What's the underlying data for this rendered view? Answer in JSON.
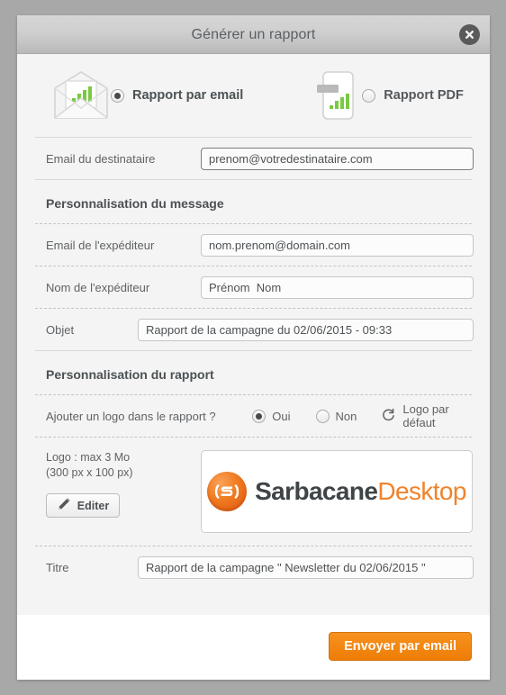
{
  "dialog": {
    "title": "Générer un rapport",
    "close_icon": "close-icon"
  },
  "report_type": {
    "options": [
      {
        "id": "email",
        "label": "Rapport par email",
        "selected": true,
        "icon": "envelope-chart-icon"
      },
      {
        "id": "pdf",
        "label": "Rapport PDF",
        "selected": false,
        "icon": "pdf-chart-icon"
      }
    ]
  },
  "recipient": {
    "label": "Email du destinataire",
    "value": "prenom@votredestinataire.com"
  },
  "message_section": {
    "heading": "Personnalisation du message",
    "fields": [
      {
        "id": "sender_email",
        "label": "Email de l'expéditeur",
        "value": "nom.prenom@domain.com"
      },
      {
        "id": "sender_name",
        "label": "Nom de l'expéditeur",
        "value": "Prénom  Nom"
      },
      {
        "id": "subject",
        "label": "Objet",
        "value": "Rapport de la campagne du 02/06/2015 - 09:33"
      }
    ]
  },
  "report_section": {
    "heading": "Personnalisation du rapport",
    "logo_question": "Ajouter un logo dans le rapport ?",
    "logo_options": [
      {
        "id": "oui",
        "label": "Oui",
        "selected": true
      },
      {
        "id": "non",
        "label": "Non",
        "selected": false
      }
    ],
    "default_logo": {
      "label": "Logo par défaut",
      "icon": "refresh-icon"
    },
    "logo_constraints_line1": "Logo : max 3 Mo",
    "logo_constraints_line2": "(300 px x 100 px)",
    "edit_button": {
      "label": "Editer",
      "icon": "pencil-icon"
    },
    "logo_preview": {
      "mark_icon": "sarbacane-circle-icon",
      "brand_primary": "Sarbacane",
      "brand_secondary": "Desktop"
    },
    "title_field": {
      "label": "Titre",
      "value": "Rapport de la campagne \" Newsletter du 02/06/2015 \""
    }
  },
  "footer": {
    "submit_label": "Envoyer par email"
  },
  "colors": {
    "accent_orange": "#ee7d06",
    "chart_green": "#7ac943",
    "header_text": "#5b5f63",
    "body_bg": "#f4f4f4"
  }
}
